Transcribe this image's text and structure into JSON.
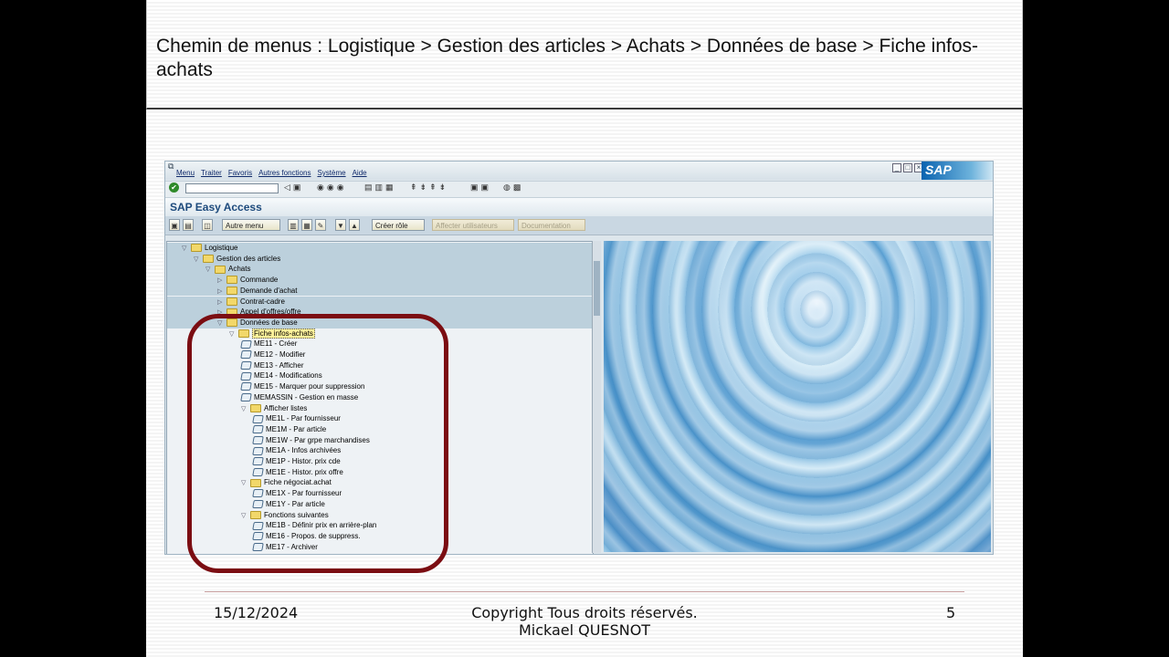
{
  "slide": {
    "title": "Chemin de menus : Logistique > Gestion des articles > Achats > Données de base > Fiche infos-achats"
  },
  "sap": {
    "menu": [
      "Menu",
      "Traiter",
      "Favoris",
      "Autres fonctions",
      "Système",
      "Aide"
    ],
    "logo": "SAP",
    "screen_title": "SAP Easy Access",
    "buttons": {
      "autre_menu": "Autre menu",
      "creer_role": "Créer rôle",
      "affecter_utilisateurs": "Affecter utilisateurs",
      "documentation": "Documentation"
    },
    "tree": [
      {
        "label": "Logistique",
        "level": 0,
        "kind": "folder-open",
        "hl": true
      },
      {
        "label": "Gestion des articles",
        "level": 1,
        "kind": "folder-open",
        "hl": true
      },
      {
        "label": "Achats",
        "level": 2,
        "kind": "folder-open",
        "hl": true
      },
      {
        "label": "Commande",
        "level": 3,
        "kind": "folder",
        "hl": true
      },
      {
        "label": "Demande d'achat",
        "level": 3,
        "kind": "folder",
        "hl": true
      },
      {
        "label": "Contrat-cadre",
        "level": 3,
        "kind": "folder",
        "hl": true
      },
      {
        "label": "Appel d'offres/offre",
        "level": 3,
        "kind": "folder",
        "hl": true
      },
      {
        "label": "Données de base",
        "level": 3,
        "kind": "folder-open",
        "hl": true
      },
      {
        "label": "Fiche infos-achats",
        "level": 4,
        "kind": "folder-open",
        "hl": false,
        "selected": true
      },
      {
        "label": "ME11 - Créer",
        "level": 5,
        "kind": "tx"
      },
      {
        "label": "ME12 - Modifier",
        "level": 5,
        "kind": "tx"
      },
      {
        "label": "ME13 - Afficher",
        "level": 5,
        "kind": "tx"
      },
      {
        "label": "ME14 - Modifications",
        "level": 5,
        "kind": "tx"
      },
      {
        "label": "ME15 - Marquer pour suppression",
        "level": 5,
        "kind": "tx"
      },
      {
        "label": "MEMASSIN - Gestion en masse",
        "level": 5,
        "kind": "tx"
      },
      {
        "label": "Afficher listes",
        "level": 5,
        "kind": "folder-open"
      },
      {
        "label": "ME1L - Par fournisseur",
        "level": 6,
        "kind": "tx"
      },
      {
        "label": "ME1M - Par article",
        "level": 6,
        "kind": "tx"
      },
      {
        "label": "ME1W - Par grpe marchandises",
        "level": 6,
        "kind": "tx"
      },
      {
        "label": "ME1A - Infos archivées",
        "level": 6,
        "kind": "tx"
      },
      {
        "label": "ME1P - Histor. prix cde",
        "level": 6,
        "kind": "tx"
      },
      {
        "label": "ME1E - Histor. prix offre",
        "level": 6,
        "kind": "tx"
      },
      {
        "label": "Fiche négociat.achat",
        "level": 5,
        "kind": "folder-open"
      },
      {
        "label": "ME1X - Par fournisseur",
        "level": 6,
        "kind": "tx"
      },
      {
        "label": "ME1Y - Par article",
        "level": 6,
        "kind": "tx"
      },
      {
        "label": "Fonctions suivantes",
        "level": 5,
        "kind": "folder-open"
      },
      {
        "label": "ME1B - Définir prix en arrière-plan",
        "level": 6,
        "kind": "tx"
      },
      {
        "label": "ME16 - Propos. de suppress.",
        "level": 6,
        "kind": "tx"
      },
      {
        "label": "ME17 - Archiver",
        "level": 6,
        "kind": "tx"
      }
    ]
  },
  "footer": {
    "date": "15/12/2024",
    "copyright_line1": "Copyright Tous droits réservés.",
    "copyright_line2": "Mickael QUESNOT",
    "page": "5"
  },
  "colors": {
    "ring": "#7b0d12",
    "sap_title": "#1d4a7c"
  }
}
